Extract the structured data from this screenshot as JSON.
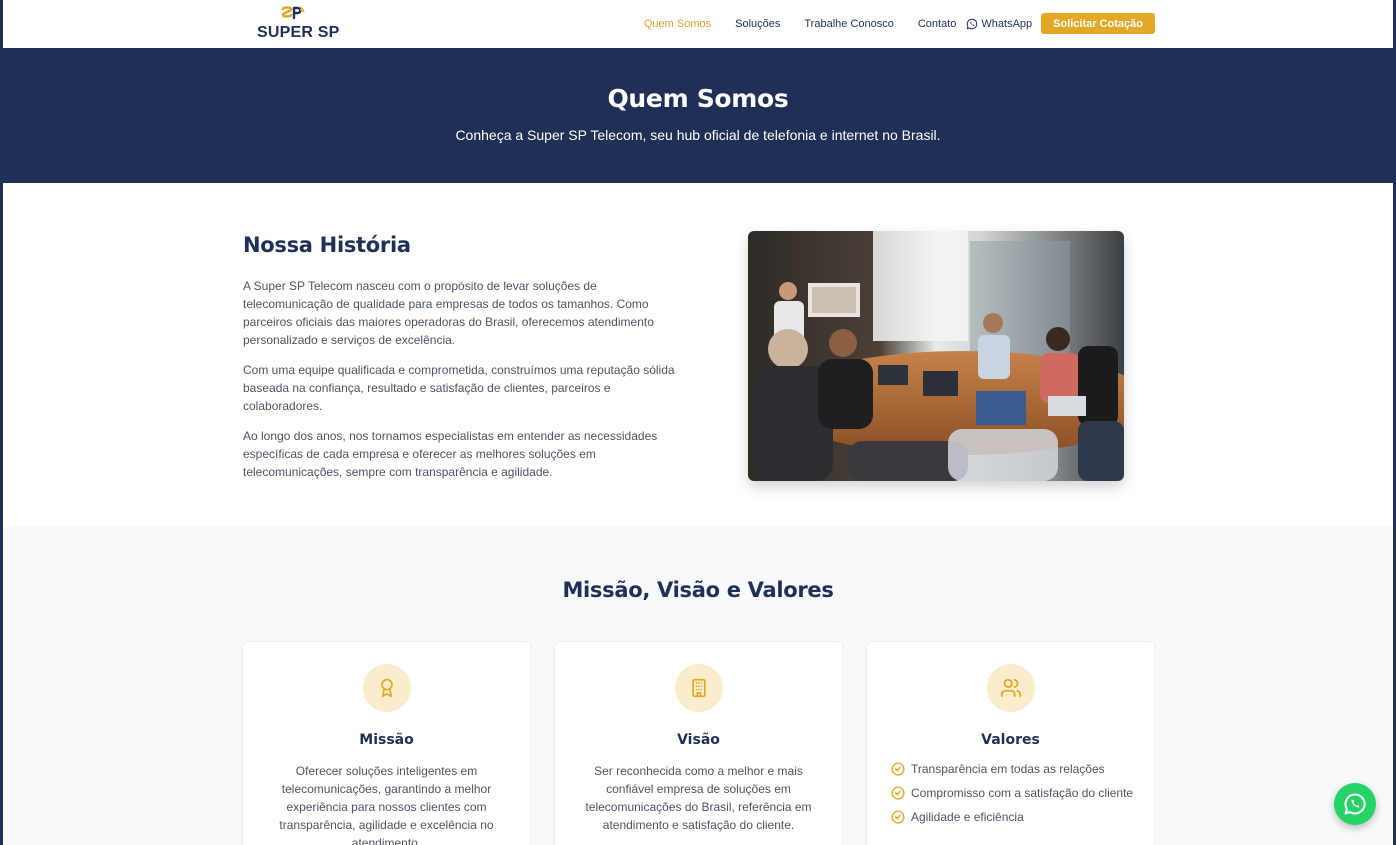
{
  "header": {
    "logo_mark": "SP",
    "logo_text": "SUPER SP",
    "nav": [
      {
        "label": "Quem Somos",
        "active": true
      },
      {
        "label": "Soluções"
      },
      {
        "label": "Trabalhe Conosco"
      },
      {
        "label": "Contato"
      }
    ],
    "whatsapp_label": "WhatsApp",
    "cta_label": "Solicitar Cotação"
  },
  "hero": {
    "title": "Quem Somos",
    "subtitle": "Conheça a Super SP Telecom, seu hub oficial de telefonia e internet no Brasil."
  },
  "history": {
    "title": "Nossa História",
    "paragraphs": [
      "A Super SP Telecom nasceu com o propósito de levar soluções de telecomunicação de qualidade para empresas de todos os tamanhos. Como parceiros oficiais das maiores operadoras do Brasil, oferecemos atendimento personalizado e serviços de excelência.",
      "Com uma equipe qualificada e comprometida, construímos uma reputação sólida baseada na confiança, resultado e satisfação de clientes, parceiros e colaboradores.",
      "Ao longo dos anos, nos tornamos especialistas em entender as necessidades específicas de cada empresa e oferecer as melhores soluções em telecomunicações, sempre com transparência e agilidade."
    ]
  },
  "mission": {
    "title": "Missão, Visão e Valores",
    "cards": [
      {
        "title": "Missão",
        "icon": "award-icon",
        "text": "Oferecer soluções inteligentes em telecomunicações, garantindo a melhor experiência para nossos clientes com transparência, agilidade e excelência no atendimento."
      },
      {
        "title": "Visão",
        "icon": "building-icon",
        "text": "Ser reconhecida como a melhor e mais confiável empresa de soluções em telecomunicações do Brasil, referência em atendimento e satisfação do cliente."
      },
      {
        "title": "Valores",
        "icon": "users-icon",
        "items": [
          "Transparência em todas as relações",
          "Compromisso com a satisfação do cliente",
          "Agilidade e eficiência"
        ]
      }
    ]
  },
  "colors": {
    "navy": "#1f2f55",
    "gold": "#e3a826",
    "whatsapp_green": "#25d366"
  }
}
